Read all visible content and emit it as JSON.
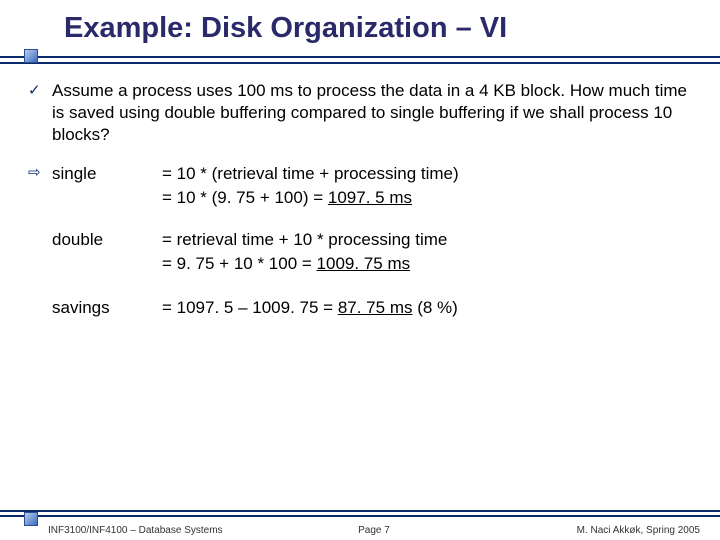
{
  "title": "Example: Disk Organization – VI",
  "bullets": {
    "check": "✓",
    "arrow": "⇨"
  },
  "question": "Assume a process uses 100 ms to process the data in a 4 KB block. How much time is saved using double buffering compared to single buffering if we shall process 10 blocks?",
  "calc": {
    "single": {
      "label": "single",
      "line1": "= 10 * (retrieval time + processing time)",
      "line2a": "= 10 * (9. 75 + 100) = ",
      "line2b": "1097. 5 ms"
    },
    "double": {
      "label": "double",
      "line1": "= retrieval time + 10 * processing time",
      "line2a": "= 9. 75 + 10 * 100 = ",
      "line2b": "1009. 75 ms"
    },
    "savings": {
      "label": "savings",
      "pre": "= 1097. 5 – 1009. 75 = ",
      "val": "87. 75 ms",
      "post": "  (8 %)"
    }
  },
  "footer": {
    "left": "INF3100/INF4100 – Database Systems",
    "mid": "Page 7",
    "right": "M. Naci Akkøk, Spring 2005"
  }
}
